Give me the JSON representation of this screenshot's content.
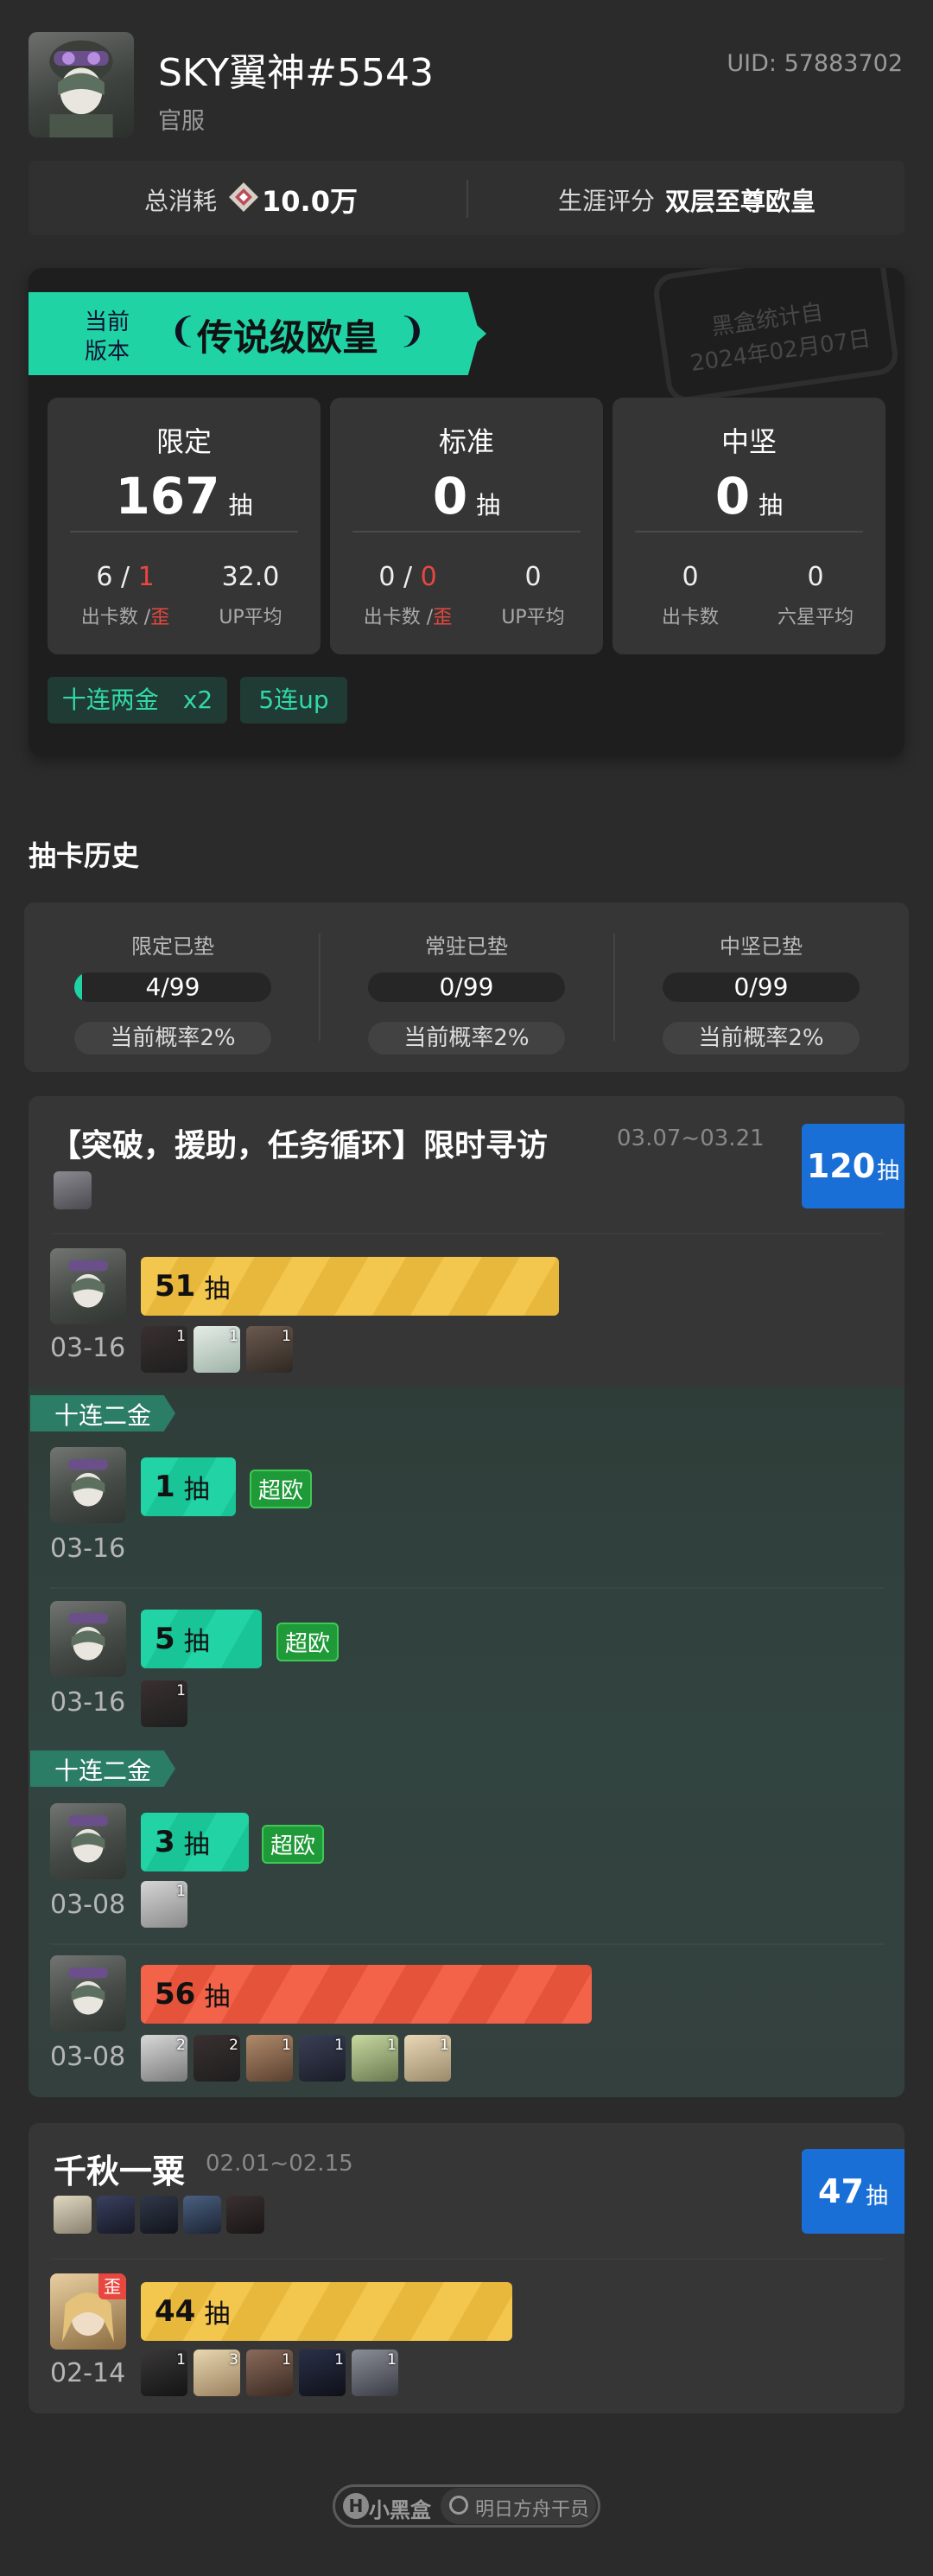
{
  "profile": {
    "name": "SKY翼神#5543",
    "server": "官服",
    "uid": "UID: 57883702"
  },
  "summary": {
    "cost_label": "总消耗",
    "cost_value": "10.0万",
    "rating_label": "生涯评分",
    "rating_value": "双层至尊欧皇"
  },
  "version_card": {
    "ribbon_small_1": "当前",
    "ribbon_small_2": "版本",
    "ribbon_title": "传说级欧皇",
    "stamp_line1": "黑盒统计自",
    "stamp_line2": "2024年02月07日",
    "pools": [
      {
        "title": "限定",
        "pulls": "167",
        "unit": "抽",
        "stat1_a": "6",
        "stat1_sep": " / ",
        "stat1_b": "1",
        "stat1_label_a": "出卡数 /",
        "stat1_label_b": "歪",
        "stat2": "32.0",
        "stat2_label": "UP平均"
      },
      {
        "title": "标准",
        "pulls": "0",
        "unit": "抽",
        "stat1_a": "0",
        "stat1_sep": " / ",
        "stat1_b": "0",
        "stat1_label_a": "出卡数 /",
        "stat1_label_b": "歪",
        "stat2": "0",
        "stat2_label": "UP平均"
      },
      {
        "title": "中坚",
        "pulls": "0",
        "unit": "抽",
        "stat1_a": "0",
        "stat1_label_a": "出卡数",
        "stat2": "0",
        "stat2_label": "六星平均"
      }
    ],
    "tags": [
      "十连两金　x2",
      "5连up"
    ]
  },
  "history": {
    "title": "抽卡历史",
    "pity": [
      {
        "label": "限定已垫",
        "value": "4/99",
        "fill": 0.04,
        "chance": "当前概率2%"
      },
      {
        "label": "常驻已垫",
        "value": "0/99",
        "fill": 0,
        "chance": "当前概率2%"
      },
      {
        "label": "中坚已垫",
        "value": "0/99",
        "fill": 0,
        "chance": "当前概率2%"
      }
    ],
    "banner1": {
      "title": "【突破，援助，任务循环】限时寻访",
      "dates": "03.07~03.21",
      "total": "120",
      "unit": "抽",
      "rows": [
        {
          "pulls": "51",
          "unit": "抽",
          "date": "03-16",
          "chars": [
            "1",
            "1",
            "1"
          ]
        },
        {
          "ribbon": "十连二金",
          "pulls": "1",
          "unit": "抽",
          "tag": "超欧",
          "date": "03-16",
          "chars": []
        },
        {
          "pulls": "5",
          "unit": "抽",
          "tag": "超欧",
          "date": "03-16",
          "chars": [
            "1"
          ]
        },
        {
          "ribbon": "十连二金",
          "pulls": "3",
          "unit": "抽",
          "tag": "超欧",
          "date": "03-08",
          "chars": [
            "1"
          ]
        },
        {
          "pulls": "56",
          "unit": "抽",
          "date": "03-08",
          "chars": [
            "2",
            "2",
            "1",
            "1",
            "1",
            "1"
          ]
        }
      ]
    },
    "banner2": {
      "title": "千秋一粟",
      "dates": "02.01~02.15",
      "total": "47",
      "unit": "抽",
      "rows": [
        {
          "pulls": "44",
          "unit": "抽",
          "badge": "歪",
          "date": "02-14",
          "chars": [
            "1",
            "3",
            "1",
            "1",
            "1"
          ]
        }
      ]
    }
  },
  "footer": {
    "brand": "小黑盒",
    "search": "明日方舟干员"
  },
  "colors": {
    "accent_green": "#1fd3a5",
    "accent_blue": "#1a6fd6",
    "bar_yellow": "#f3c64e",
    "bar_red": "#f2634a",
    "warn_red": "#e8473f"
  }
}
